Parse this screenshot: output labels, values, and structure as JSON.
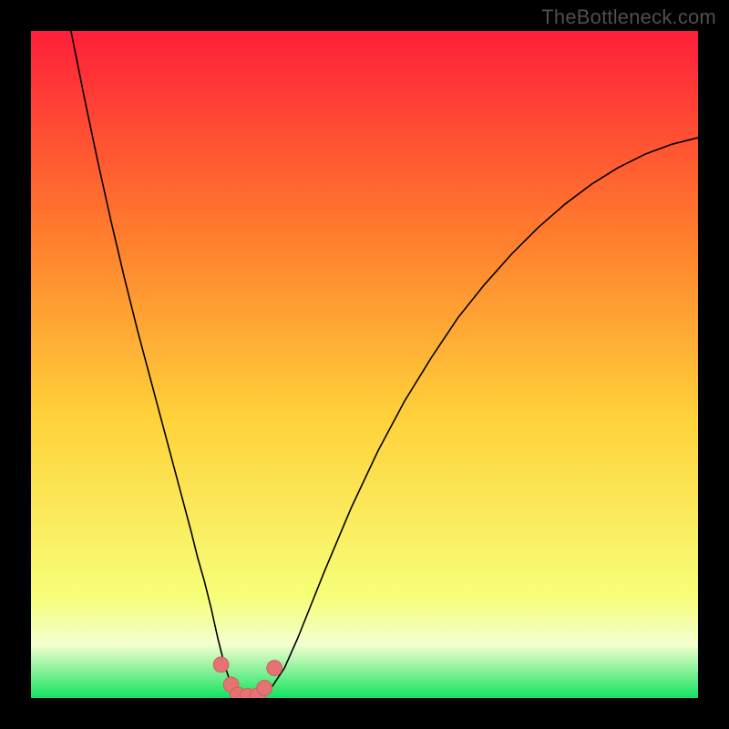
{
  "watermark": "TheBottleneck.com",
  "colors": {
    "frame": "#000000",
    "gradient_top": "#ff1f3a",
    "gradient_mid_upper": "#ff7b2d",
    "gradient_mid": "#ffd23a",
    "gradient_lower": "#f7ff7a",
    "gradient_band": "#f3ffcf",
    "gradient_bottom": "#13e35f",
    "curve": "#000000",
    "marker_fill": "#e57373",
    "marker_stroke": "#cc5a5a"
  },
  "chart_data": {
    "type": "line",
    "title": "",
    "xlabel": "",
    "ylabel": "",
    "xlim": [
      0,
      100
    ],
    "ylim": [
      0,
      100
    ],
    "curve": {
      "name": "bottleneck-curve",
      "x": [
        6,
        8,
        10,
        12,
        14,
        16,
        18,
        20,
        22,
        24,
        25,
        26,
        27,
        28,
        29,
        30,
        31,
        32,
        34,
        36,
        38,
        40,
        44,
        48,
        52,
        56,
        60,
        64,
        68,
        72,
        76,
        80,
        84,
        88,
        92,
        96,
        100
      ],
      "y": [
        100,
        90,
        80.5,
        71.5,
        63,
        55,
        47.5,
        40,
        32.5,
        25,
        21,
        17.5,
        13.5,
        9,
        5,
        2,
        0.5,
        0.2,
        0.2,
        1.5,
        4.5,
        9,
        19,
        28.5,
        37,
        44.5,
        51,
        57,
        62,
        66.5,
        70.5,
        74,
        77,
        79.5,
        81.5,
        83,
        84
      ]
    },
    "markers": {
      "name": "bottleneck-markers",
      "points": [
        {
          "x": 28.5,
          "y": 5
        },
        {
          "x": 30,
          "y": 2
        },
        {
          "x": 31,
          "y": 0.5
        },
        {
          "x": 32.5,
          "y": 0.3
        },
        {
          "x": 34,
          "y": 0.4
        },
        {
          "x": 35,
          "y": 1.5
        },
        {
          "x": 36.5,
          "y": 4.5
        }
      ]
    }
  }
}
